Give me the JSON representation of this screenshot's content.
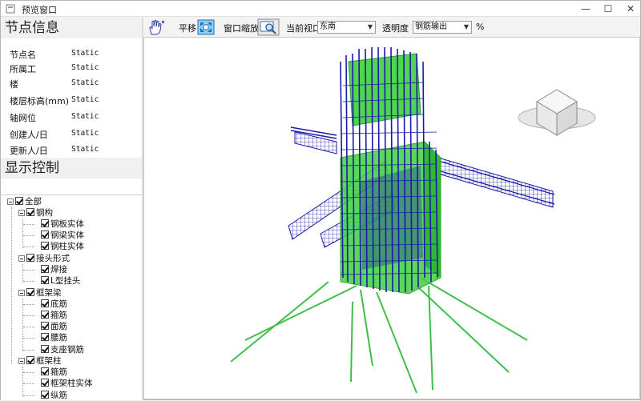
{
  "window": {
    "title": "预览窗口"
  },
  "toolbar": {
    "pan_label": "平移",
    "zoom_label": "窗口缩放",
    "view_label": "当前视口",
    "view_value": "东南",
    "opacity_label": "透明度",
    "opacity_value": "钢筋输出",
    "percent_label": "%"
  },
  "node_info": {
    "heading": "节点信息",
    "props": [
      {
        "label": "节点名",
        "value": "Static"
      },
      {
        "label": "所属工",
        "value": "Static"
      },
      {
        "label": "楼",
        "value": "Static"
      },
      {
        "label": "楼层标高(mm)",
        "value": "Static"
      },
      {
        "label": "轴网位",
        "value": "Static"
      },
      {
        "label": "创建人/日",
        "value": "Static"
      },
      {
        "label": "更新人/日",
        "value": "Static"
      }
    ]
  },
  "display_control": {
    "heading": "显示控制",
    "tree": [
      {
        "label": "全部"
      },
      {
        "label": "钢构"
      },
      {
        "label": "钢板实体"
      },
      {
        "label": "钢梁实体"
      },
      {
        "label": "钢柱实体"
      },
      {
        "label": "接头形式"
      },
      {
        "label": "焊接"
      },
      {
        "label": "L型挂头"
      },
      {
        "label": "框架梁"
      },
      {
        "label": "底筋"
      },
      {
        "label": "箍筋"
      },
      {
        "label": "面筋"
      },
      {
        "label": "腰筋"
      },
      {
        "label": "支座钢筋"
      },
      {
        "label": "框架柱"
      },
      {
        "label": "箍筋"
      },
      {
        "label": "框架柱实体"
      },
      {
        "label": "纵筋"
      }
    ]
  },
  "colors": {
    "rebar_blue": "#1a1aa8",
    "steel_green": "#3fd13f",
    "pile_green": "#3fbf4a"
  }
}
